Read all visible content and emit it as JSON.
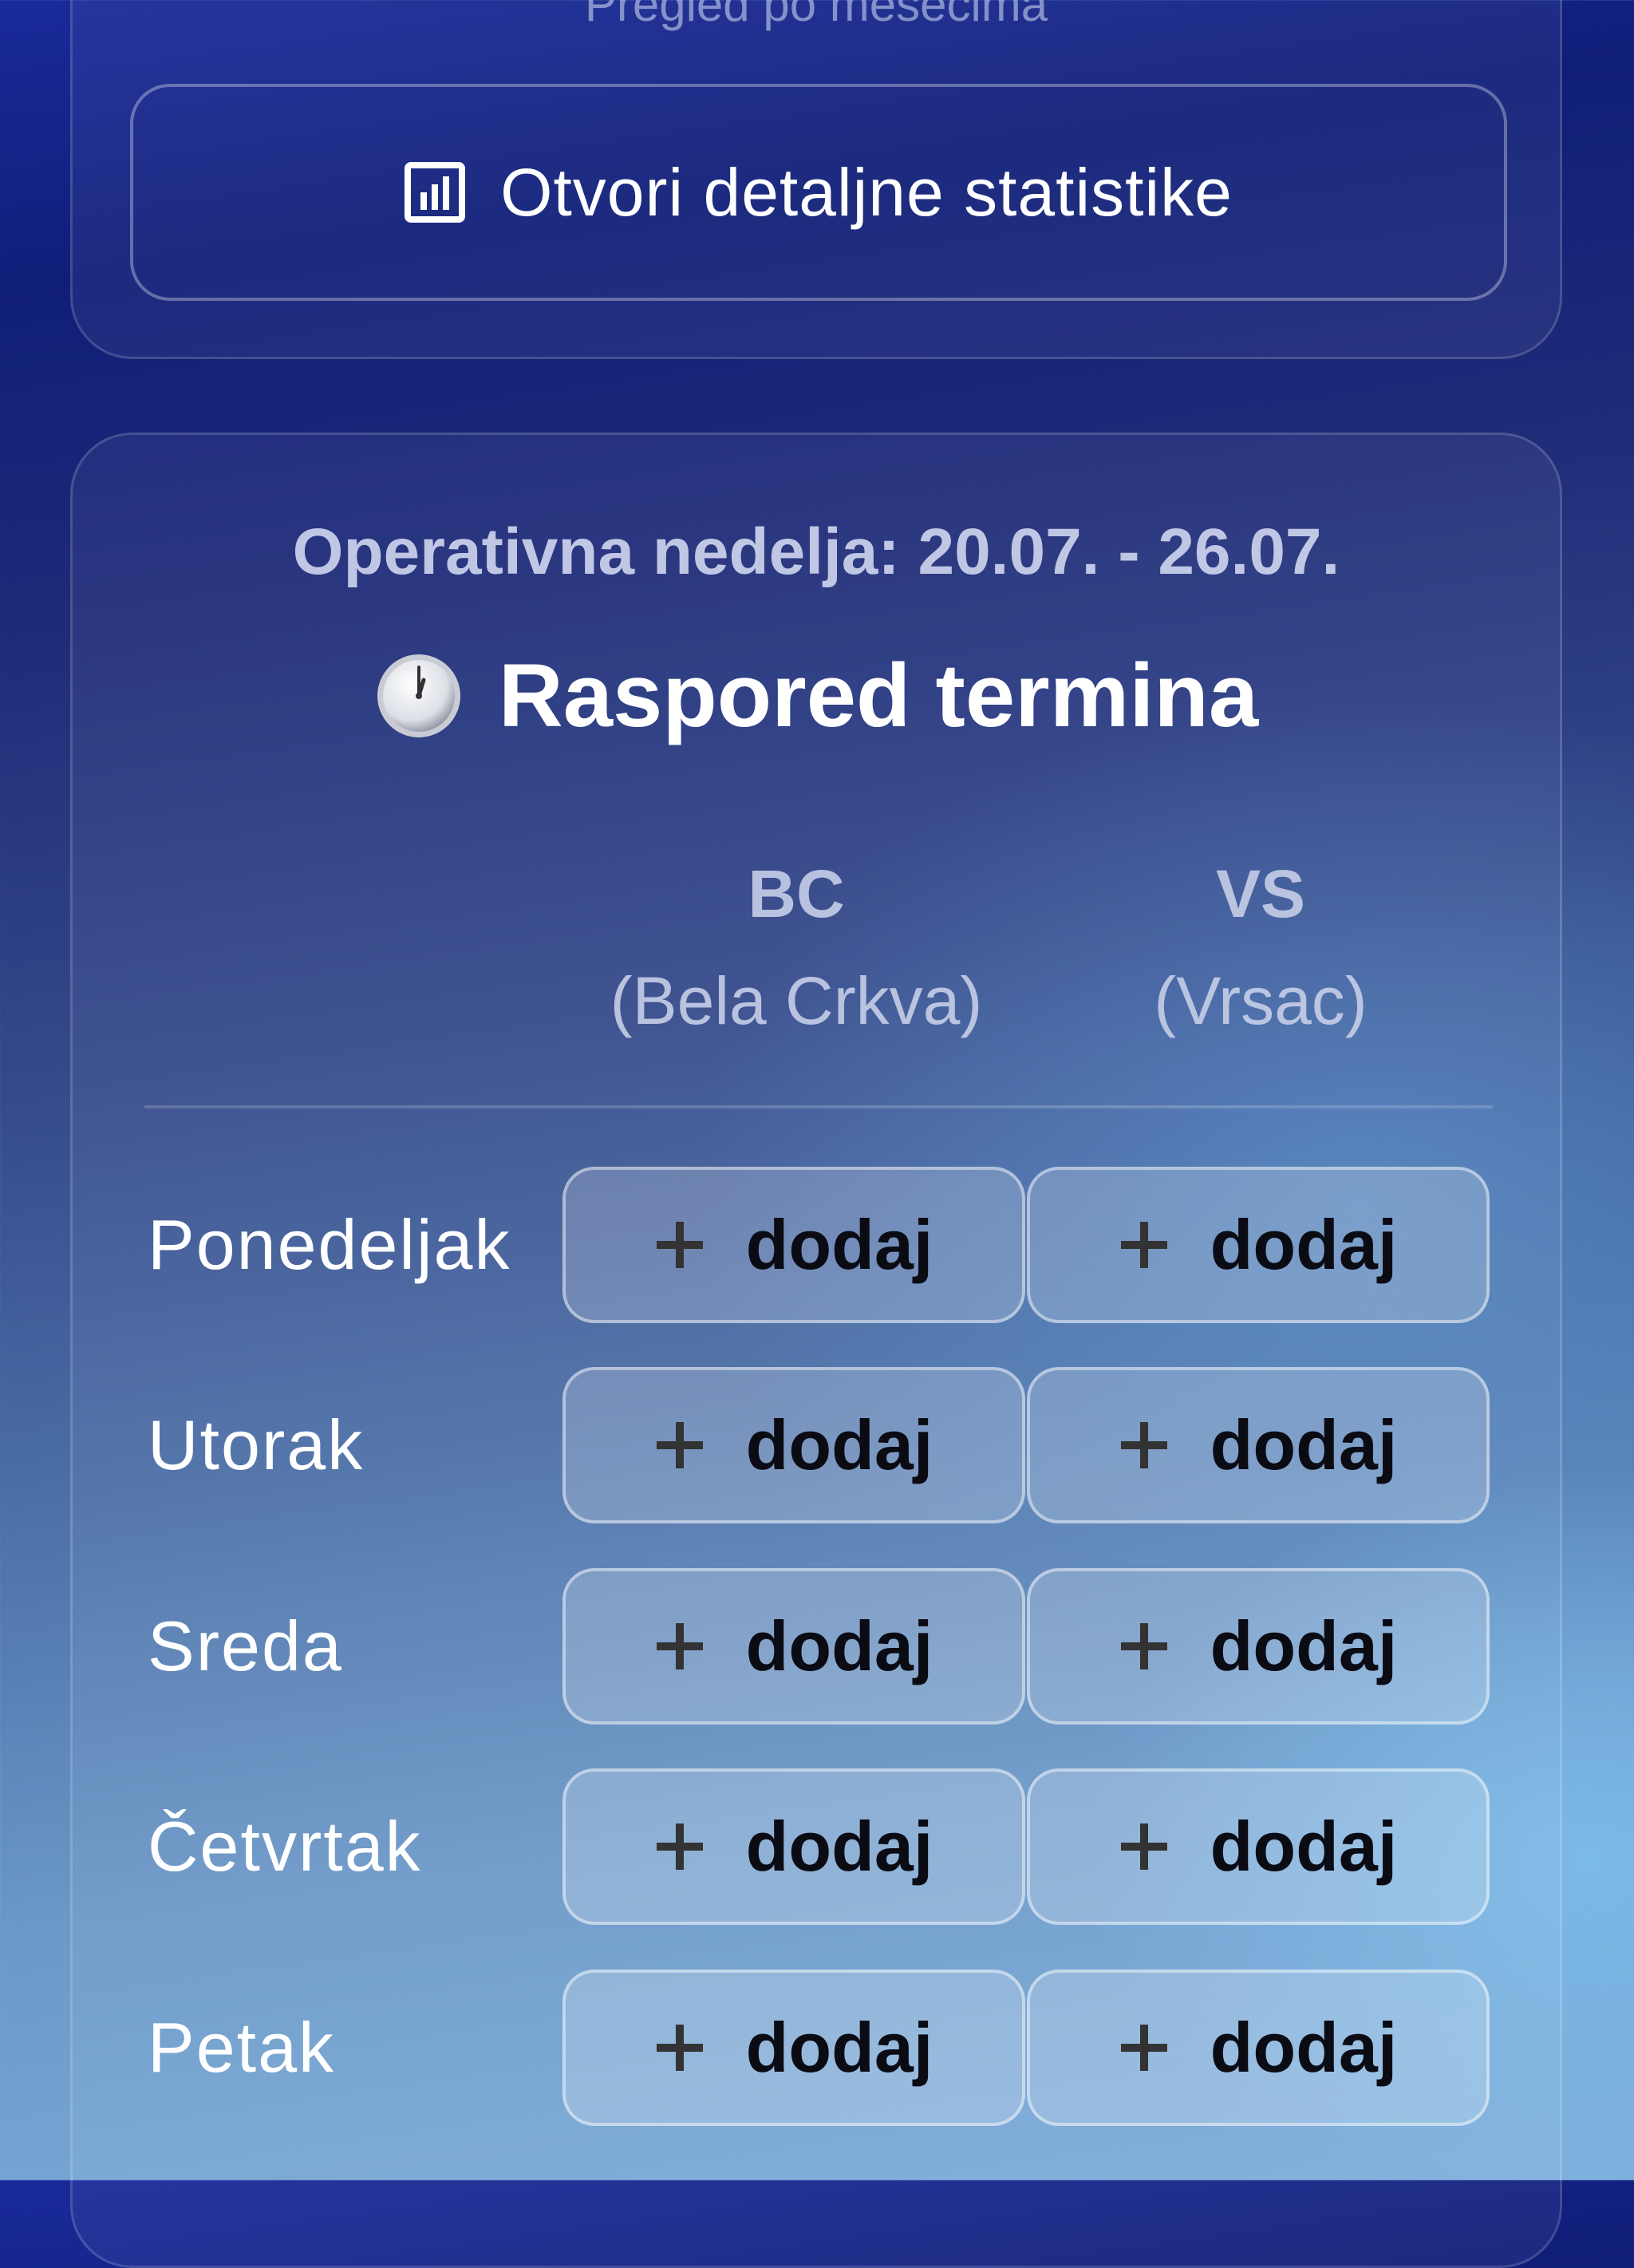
{
  "stats_card": {
    "caption": "Pregled po mesecima",
    "open_stats_label": "Otvori detaljne statistike",
    "icon": "bar-chart-icon"
  },
  "schedule": {
    "week_label": "Operativna nedelja: 20.07. - 26.07.",
    "title_icon": "clock-emoji-icon",
    "title": "Raspored termina",
    "columns": [
      {
        "code": "BC",
        "city": "(Bela Crkva)"
      },
      {
        "code": "VS",
        "city": "(Vrsac)"
      }
    ],
    "add_label": "dodaj",
    "add_icon": "plus-icon",
    "days": [
      {
        "name": "Ponedeljak"
      },
      {
        "name": "Utorak"
      },
      {
        "name": "Sreda"
      },
      {
        "name": "Četvrtak"
      },
      {
        "name": "Petak"
      }
    ]
  }
}
